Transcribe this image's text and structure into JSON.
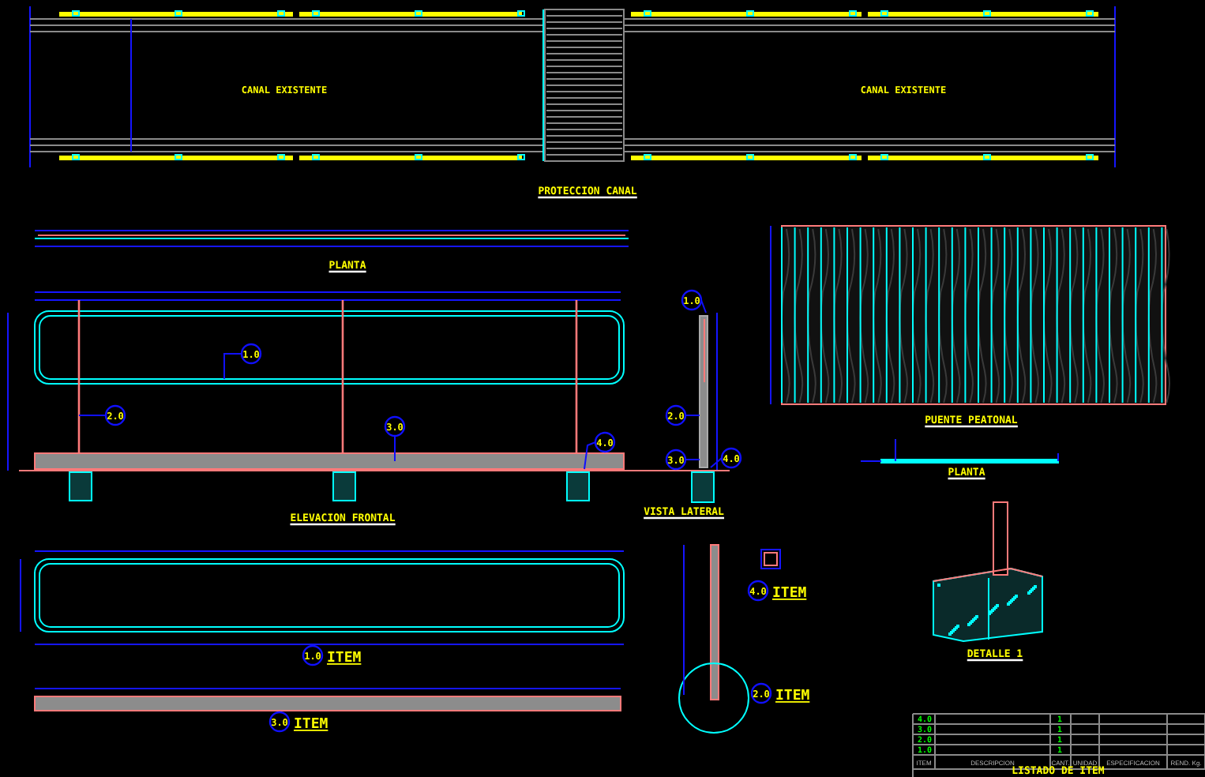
{
  "canal_plan": {
    "labels": [
      "CANAL EXISTENTE",
      "CANAL EXISTENTE"
    ],
    "title": "PROTECCION CANAL"
  },
  "plan_view": {
    "title": "PLANTA"
  },
  "front_elevation": {
    "title": "ELEVACION FRONTAL",
    "callouts": [
      "1.0",
      "2.0",
      "3.0",
      "4.0"
    ]
  },
  "side_view": {
    "title": "VISTA LATERAL",
    "callouts": [
      "1.0",
      "2.0",
      "3.0",
      "4.0"
    ]
  },
  "footbridge": {
    "title": "PUENTE PEATONAL",
    "plan_title": "PLANTA"
  },
  "items": [
    {
      "number": "1.0",
      "label": "ITEM"
    },
    {
      "number": "3.0",
      "label": "ITEM"
    },
    {
      "number": "4.0",
      "label": "ITEM"
    },
    {
      "number": "2.0",
      "label": "ITEM"
    }
  ],
  "detail": {
    "title": "DETALLE 1"
  },
  "item_table": {
    "columns": [
      "ITEM",
      "DESCRIPCION",
      "CANT.",
      "UNIDAD",
      "ESPECIFICACION",
      "REND. Kg."
    ],
    "rows": [
      {
        "item": "4.0",
        "quantity": "1"
      },
      {
        "item": "3.0",
        "quantity": "1"
      },
      {
        "item": "2.0",
        "quantity": "1"
      },
      {
        "item": "1.0",
        "quantity": "1"
      }
    ],
    "title": "LISTADO DE ITEM"
  }
}
